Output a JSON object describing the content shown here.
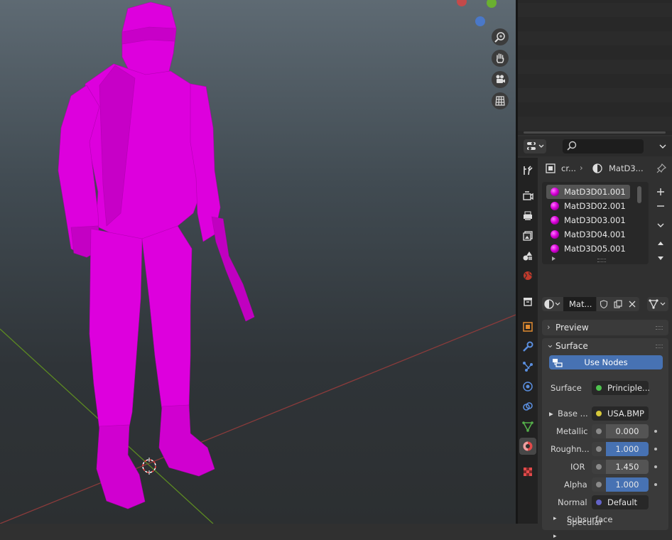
{
  "viewport": {
    "nav_icons": [
      "zoom-icon",
      "hand-pan-icon",
      "camera-icon",
      "grid-icon"
    ]
  },
  "properties": {
    "breadcrumb": {
      "object": "cr...",
      "material": "MatD3..."
    },
    "material_slots": [
      "MatD3D01.001",
      "MatD3D02.001",
      "MatD3D03.001",
      "MatD3D04.001",
      "MatD3D05.001"
    ],
    "material_name": "Mat...",
    "panels": {
      "preview": "Preview",
      "surface": "Surface"
    },
    "use_nodes": "Use Nodes",
    "surface": {
      "label": "Surface",
      "value": "Principle..."
    },
    "base_color": {
      "label": "Base ...",
      "value": "USA.BMP"
    },
    "metallic": {
      "label": "Metallic",
      "value": "0.000",
      "fill": 0.0
    },
    "roughness": {
      "label": "Roughn...",
      "value": "1.000",
      "fill": 1.0
    },
    "ior": {
      "label": "IOR",
      "value": "1.450",
      "fill": 0.0
    },
    "alpha": {
      "label": "Alpha",
      "value": "1.000",
      "fill": 1.0
    },
    "normal": {
      "label": "Normal",
      "value": "Default"
    },
    "subsurface": "Subsurface",
    "specular": "Specular"
  },
  "colors": {
    "model": "#dd00dd",
    "accent": "#4772b3",
    "x_axis": "#9a3a3a",
    "y_axis": "#5a8a2a"
  }
}
